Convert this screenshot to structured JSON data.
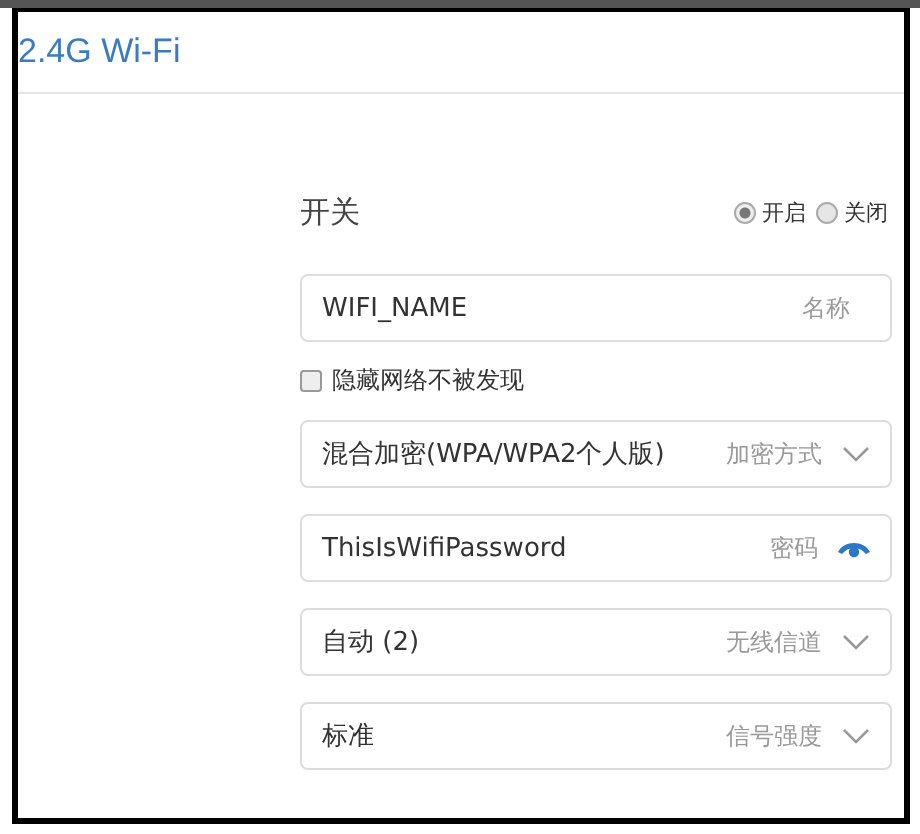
{
  "header": {
    "title": "2.4G Wi-Fi"
  },
  "switch": {
    "label": "开关",
    "options": [
      {
        "label": "开启",
        "selected": true
      },
      {
        "label": "关闭",
        "selected": false
      }
    ]
  },
  "name_field": {
    "value": "WIFI_NAME",
    "label": "名称"
  },
  "hide_network": {
    "label": "隐藏网络不被发现",
    "checked": false
  },
  "fields": [
    {
      "kind": "select",
      "value": "混合加密(WPA/WPA2个人版)",
      "label": "加密方式"
    },
    {
      "kind": "password",
      "value": "ThisIsWifiPassword",
      "label": "密码"
    },
    {
      "kind": "select",
      "value": "自动 (2)",
      "label": "无线信道"
    },
    {
      "kind": "select",
      "value": "标准",
      "label": "信号强度"
    }
  ]
}
